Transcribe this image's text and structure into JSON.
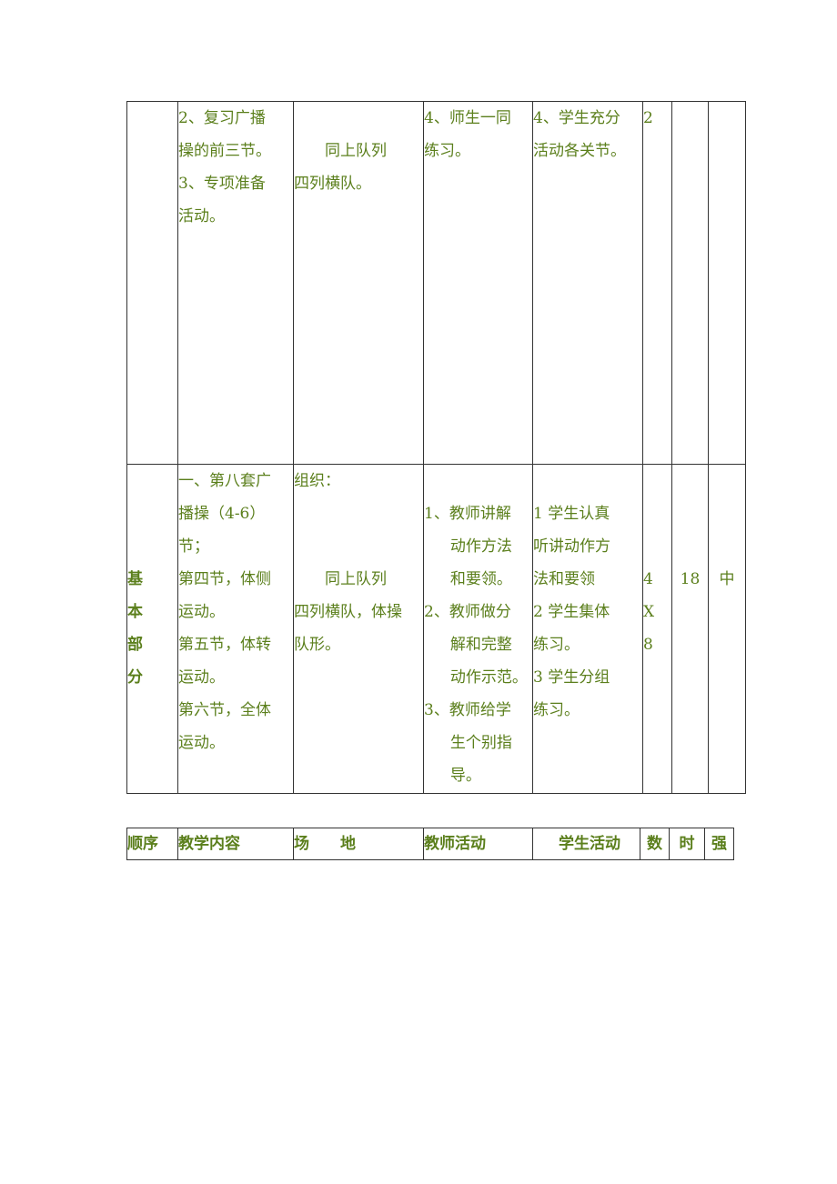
{
  "main_table": {
    "row1": {
      "section": "",
      "content": [
        "2、复习广播",
        "操的前三节。",
        "3、专项准备",
        "活动。"
      ],
      "venue": [
        "同上队列",
        "四列横队。"
      ],
      "teacher": [
        "4、师生一同",
        "练习。"
      ],
      "student": [
        "4、学生充分",
        "活动各关节。"
      ],
      "count": "2",
      "time": "",
      "intensity": ""
    },
    "row2": {
      "section": [
        "基",
        "本",
        "部",
        "分"
      ],
      "content": [
        "一、第八套广",
        "播操（4-6）",
        "节；",
        "第四节，体侧",
        "运动。",
        "第五节，体转",
        "运动。",
        "第六节，全体",
        "运动。"
      ],
      "venue": [
        "组织：",
        "同上队列",
        "四列横队，体操",
        "队形。"
      ],
      "teacher": [
        {
          "num": "1、",
          "lines": [
            "教师讲解",
            "动作方法",
            "和要领。"
          ]
        },
        {
          "num": "2、",
          "lines": [
            "教师做分",
            "解和完整",
            "动作示范。"
          ]
        },
        {
          "num": "3、",
          "lines": [
            "教师给学",
            "生个别指",
            "导。"
          ]
        }
      ],
      "student": [
        "1 学生认真",
        "听讲动作方",
        "法和要领",
        "2 学生集体",
        "练习。",
        "3 学生分组",
        "练习。"
      ],
      "count": [
        "4",
        "X",
        "8"
      ],
      "time": "18",
      "intensity": "中"
    }
  },
  "header_table": {
    "order": "顺序",
    "content": "教学内容",
    "venue": "场　　地",
    "teacher": "教师活动",
    "student": "学生活动",
    "count": "数",
    "time": "时",
    "intensity": "强"
  }
}
